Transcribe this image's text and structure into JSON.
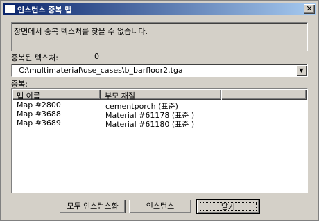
{
  "window": {
    "title": "인스턴스 중복 맵"
  },
  "message": "장면에서 중복 텍스처를 찾을 수 없습니다.",
  "duplicate_texture": {
    "label": "중복된 텍스처:",
    "count": "0"
  },
  "texture_path": "C:\\multimaterial\\use_cases\\b_barfloor2.tga",
  "duplicates_label": "중복:",
  "table": {
    "columns": [
      "맵 이름",
      "부모 재질"
    ],
    "rows": [
      [
        "Map #2800",
        "cementporch (표준)"
      ],
      [
        "Map #3688",
        "Material #61178 (표준 )"
      ],
      [
        "Map #3689",
        "Material #61180 (표준 )"
      ]
    ]
  },
  "buttons": {
    "instance_all": "모두 인스턴스화",
    "instance": "인스턴스",
    "close": "닫기"
  },
  "icons": {
    "close": "close-icon",
    "dropdown": "chevron-down-icon",
    "title": "window-icon"
  }
}
